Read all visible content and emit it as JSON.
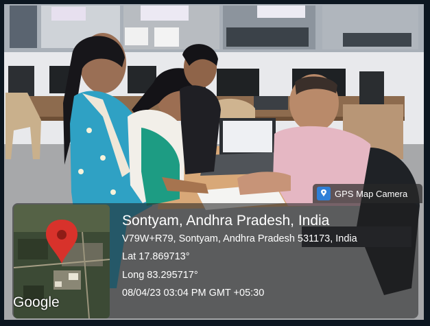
{
  "overlay": {
    "app_tag": "GPS Map Camera",
    "app_icon": "map-pin-app-icon",
    "location_title": "Sontyam, Andhra Pradesh, India",
    "address": "V79W+R79, Sontyam, Andhra Pradesh 531173, India",
    "latitude": "Lat 17.869713°",
    "longitude": "Long 83.295717°",
    "timestamp": "08/04/23 03:04 PM GMT +05:30",
    "map_logo": "Google",
    "map_marker": "red-location-pin-icon",
    "colors": {
      "pin": "#d8322b",
      "tag_icon": "#2f7fd7",
      "card": "#1e1e1e"
    }
  }
}
